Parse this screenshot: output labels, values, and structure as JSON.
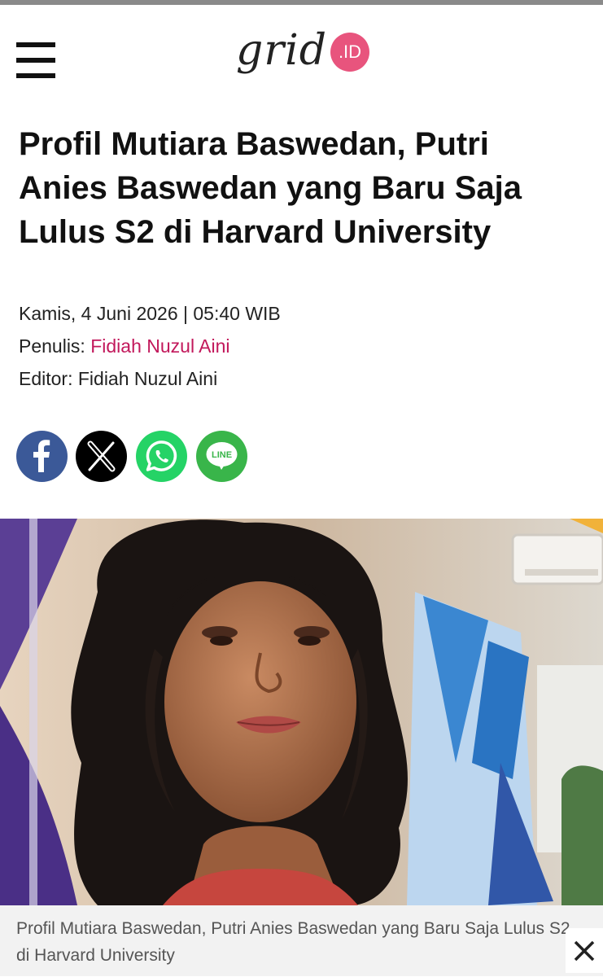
{
  "header": {
    "logo_text": "grid",
    "logo_badge": ".ID"
  },
  "article": {
    "title": "Profil Mutiara Baswedan, Putri Anies Baswedan yang Baru Saja Lulus S2 di Harvard University",
    "date": "Kamis, 4 Juni 2026 | 05:40 WIB",
    "author_label": "Penulis:",
    "author_name": "Fidiah Nuzul Aini",
    "editor_label": "Editor:",
    "editor_name": "Fidiah Nuzul Aini",
    "caption": "Profil Mutiara Baswedan, Putri Anies Baswedan yang Baru Saja Lulus S2 di Harvard University"
  },
  "share": {
    "line_label": "LINE"
  },
  "icons": [
    "menu-icon",
    "facebook-icon",
    "x-icon",
    "whatsapp-icon",
    "line-icon",
    "close-icon"
  ],
  "colors": {
    "brand_pink": "#e8547d",
    "author_link": "#c2185b",
    "facebook": "#3b5998",
    "whatsapp": "#25d366",
    "line": "#39b54a"
  }
}
